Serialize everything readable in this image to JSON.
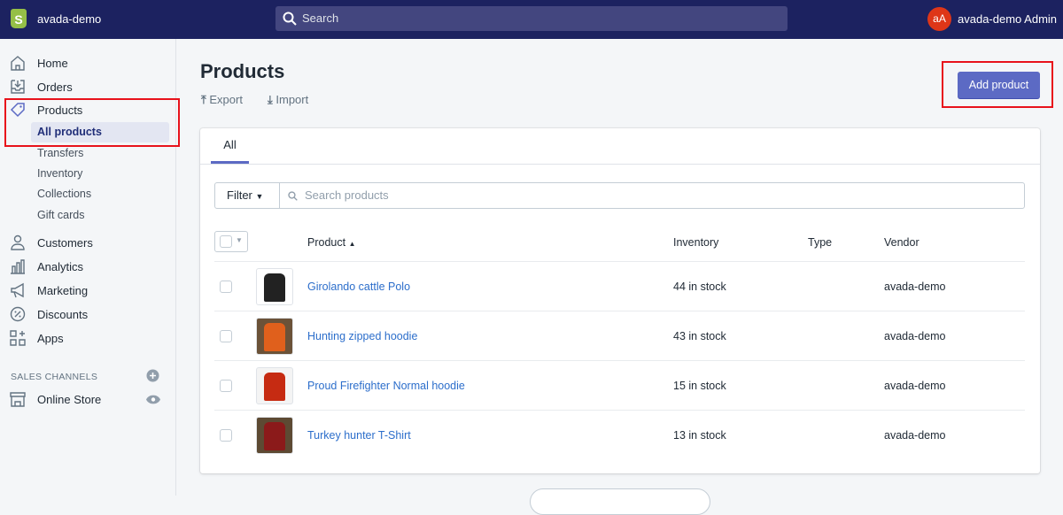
{
  "topbar": {
    "store_name": "avada-demo",
    "search_placeholder": "Search",
    "avatar_initials": "aA",
    "user_name": "avada-demo Admin"
  },
  "sidebar": {
    "items": [
      {
        "label": "Home"
      },
      {
        "label": "Orders"
      },
      {
        "label": "Products"
      },
      {
        "label": "Customers"
      },
      {
        "label": "Analytics"
      },
      {
        "label": "Marketing"
      },
      {
        "label": "Discounts"
      },
      {
        "label": "Apps"
      }
    ],
    "product_sub": [
      "All products",
      "Transfers",
      "Inventory",
      "Collections",
      "Gift cards"
    ],
    "sales_channels_label": "SALES CHANNELS",
    "online_store": "Online Store"
  },
  "page": {
    "title": "Products",
    "export": "Export",
    "import": "Import",
    "add_product": "Add product"
  },
  "card": {
    "tab": "All",
    "filter": "Filter",
    "search_placeholder": "Search products",
    "columns": [
      "Product",
      "Inventory",
      "Type",
      "Vendor"
    ],
    "rows": [
      {
        "name": "Girolando cattle Polo",
        "inventory": "44 in stock",
        "type": "",
        "vendor": "avada-demo",
        "colors": [
          "#ffffff",
          "#222222"
        ]
      },
      {
        "name": "Hunting zipped hoodie",
        "inventory": "43 in stock",
        "type": "",
        "vendor": "avada-demo",
        "colors": [
          "#6b5238",
          "#e0601c"
        ]
      },
      {
        "name": "Proud Firefighter Normal hoodie",
        "inventory": "15 in stock",
        "type": "",
        "vendor": "avada-demo",
        "colors": [
          "#f4f4f4",
          "#c62b12"
        ]
      },
      {
        "name": "Turkey hunter T-Shirt",
        "inventory": "13 in stock",
        "type": "",
        "vendor": "avada-demo",
        "colors": [
          "#5d4a33",
          "#8b1a1a"
        ]
      }
    ]
  },
  "colors": {
    "topbar": "#1c2260",
    "accent": "#5c6ac4",
    "link": "#2c6ecb",
    "highlight": "#e8121b"
  }
}
